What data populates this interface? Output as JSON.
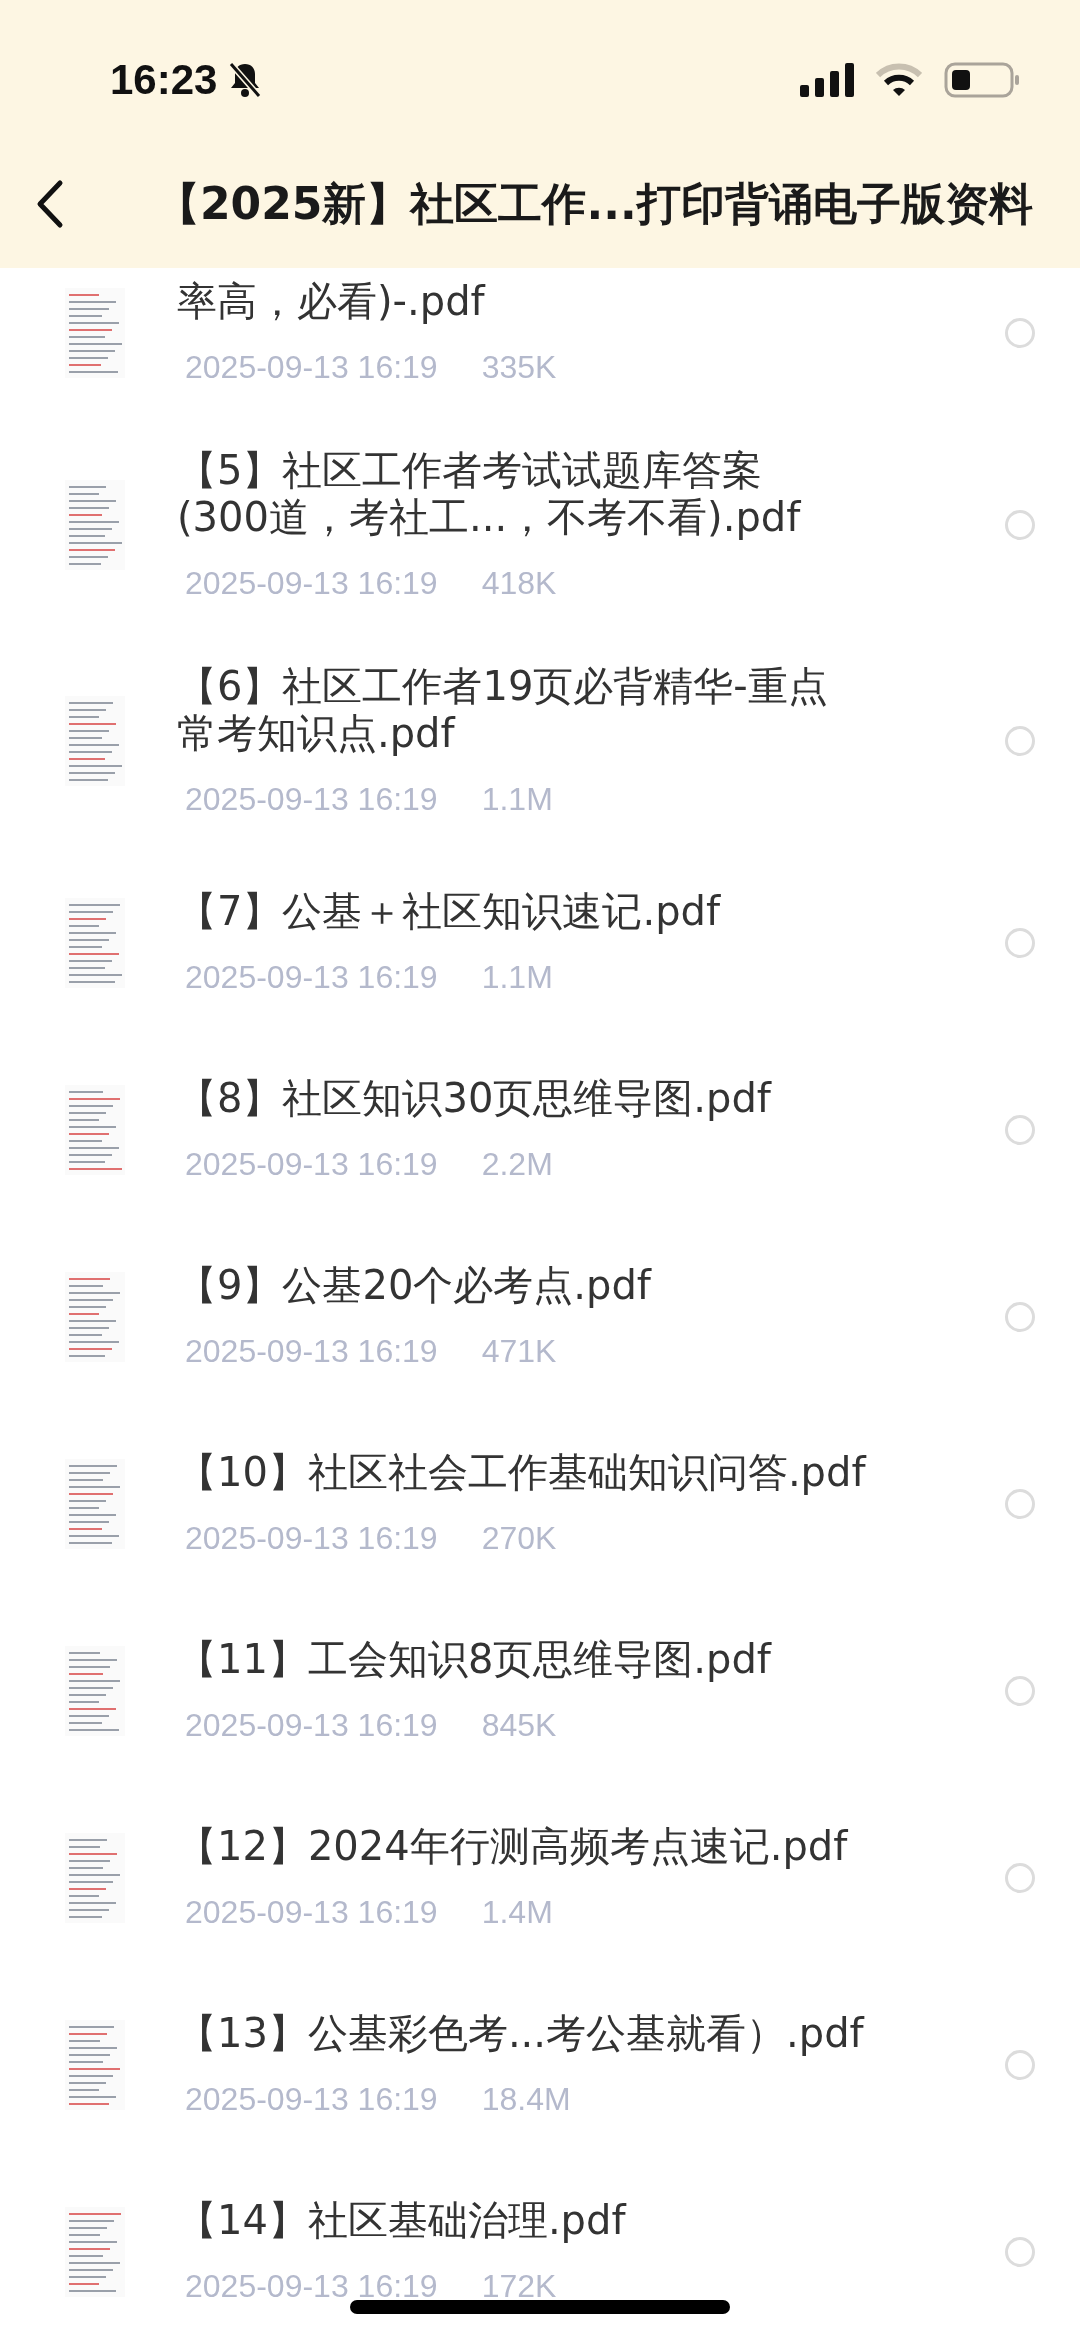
{
  "status_bar": {
    "time": "16:23",
    "silent": true
  },
  "header": {
    "title": "【2025新】社区工作...打印背诵电子版资料"
  },
  "files": [
    {
      "name_lines": [
        "率高，必看)-.pdf"
      ],
      "date": "2025-09-13 16:19",
      "size": "335K",
      "selected": false,
      "partial": true
    },
    {
      "name_lines": [
        "【5】社区工作者考试试题库答案",
        "(300道，考社工...，不考不看).pdf"
      ],
      "date": "2025-09-13 16:19",
      "size": "418K",
      "selected": false
    },
    {
      "name_lines": [
        "【6】社区工作者19页必背精华-重点",
        "常考知识点.pdf"
      ],
      "date": "2025-09-13 16:19",
      "size": "1.1M",
      "selected": false
    },
    {
      "name_lines": [
        "【7】公基＋社区知识速记.pdf"
      ],
      "date": "2025-09-13 16:19",
      "size": "1.1M",
      "selected": false
    },
    {
      "name_lines": [
        "【8】社区知识30页思维导图.pdf"
      ],
      "date": "2025-09-13 16:19",
      "size": "2.2M",
      "selected": false
    },
    {
      "name_lines": [
        "【9】公基20个必考点.pdf"
      ],
      "date": "2025-09-13 16:19",
      "size": "471K",
      "selected": false
    },
    {
      "name_lines": [
        "【10】社区社会工作基础知识问答.pdf"
      ],
      "date": "2025-09-13 16:19",
      "size": "270K",
      "selected": false
    },
    {
      "name_lines": [
        "【11】工会知识8页思维导图.pdf"
      ],
      "date": "2025-09-13 16:19",
      "size": "845K",
      "selected": false
    },
    {
      "name_lines": [
        "【12】2024年行测高频考点速记.pdf"
      ],
      "date": "2025-09-13 16:19",
      "size": "1.4M",
      "selected": false
    },
    {
      "name_lines": [
        "【13】公基彩色考...考公基就看）.pdf"
      ],
      "date": "2025-09-13 16:19",
      "size": "18.4M",
      "selected": false
    },
    {
      "name_lines": [
        "【14】社区基础治理.pdf"
      ],
      "date": "2025-09-13 16:19",
      "size": "172K",
      "selected": false
    }
  ]
}
